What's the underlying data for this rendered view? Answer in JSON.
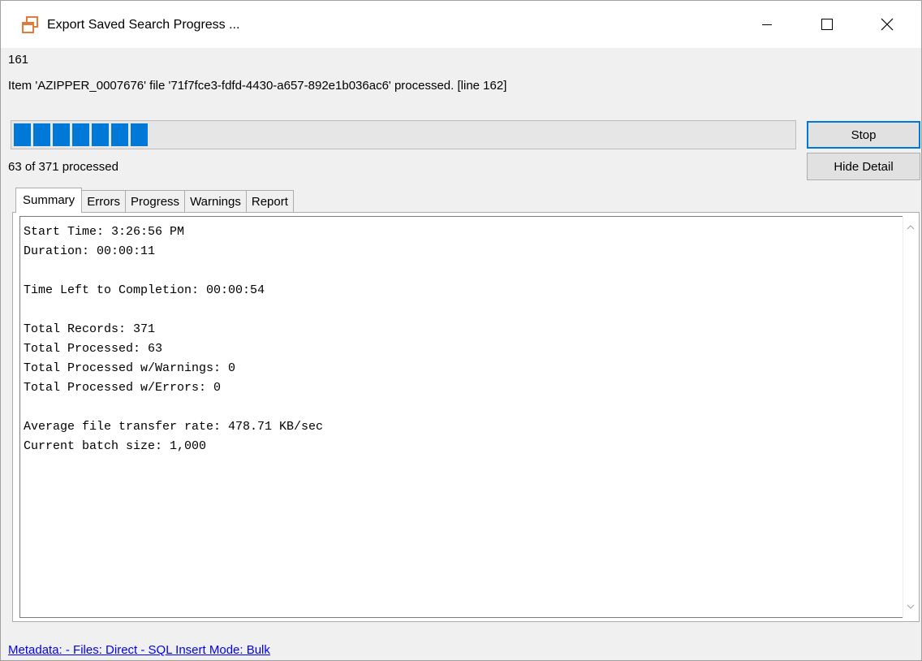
{
  "window": {
    "title": "Export Saved Search Progress ...",
    "controls": {
      "minimize": "minimize",
      "maximize": "maximize",
      "close": "close"
    }
  },
  "status": {
    "current_line": "161",
    "message": "Item 'AZIPPER_0007676' file '71f7fce3-fdfd-4430-a657-892e1b036ac6' processed. [line 162]",
    "processed_text": "63 of 371 processed",
    "progress_fraction": 0.17
  },
  "buttons": {
    "stop": "Stop",
    "hide_detail": "Hide Detail"
  },
  "tabs": [
    {
      "label": "Summary",
      "active": true
    },
    {
      "label": "Errors",
      "active": false
    },
    {
      "label": "Progress",
      "active": false
    },
    {
      "label": "Warnings",
      "active": false
    },
    {
      "label": "Report",
      "active": false
    }
  ],
  "summary": {
    "lines": [
      "Start Time: 3:26:56 PM",
      "Duration: 00:00:11",
      "",
      "Time Left to Completion: 00:00:54",
      "",
      "Total Records: 371",
      "Total Processed: 63",
      "Total Processed w/Warnings: 0",
      "Total Processed w/Errors: 0",
      "",
      "Average file transfer rate: 478.71 KB/sec",
      "Current batch size: 1,000"
    ]
  },
  "footer": {
    "link_text": "Metadata:  - Files: Direct - SQL Insert Mode: Bulk"
  },
  "colors": {
    "accent": "#0078d7",
    "link": "#0000ee",
    "icon": "#e07b39"
  }
}
